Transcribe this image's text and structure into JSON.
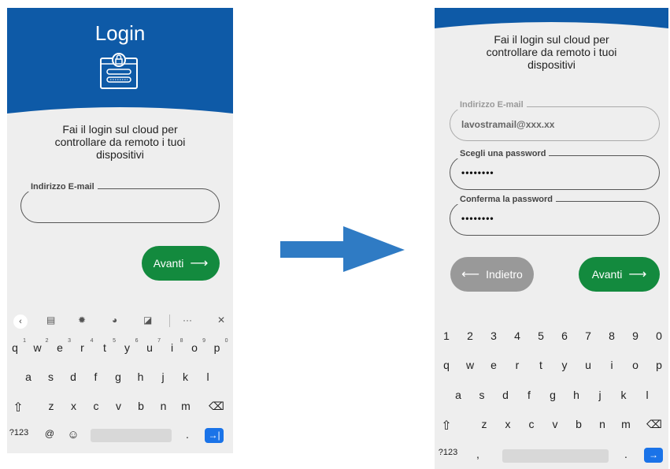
{
  "left_screen": {
    "title": "Login",
    "message_lines": [
      "Fai il login sul cloud per",
      "controllare da remoto i tuoi",
      "dispositivi"
    ],
    "email_label": "Indirizzo E-mail",
    "email_value": "",
    "next_button": "Avanti",
    "header_color": "#0e5aa7",
    "icon": "login-form-lock-icon"
  },
  "right_screen": {
    "message_lines": [
      "Fai il login sul cloud per",
      "controllare da remoto i tuoi",
      "dispositivi"
    ],
    "email_label": "Indirizzo E-mail",
    "email_value": "lavostramail@xxx.xx",
    "password_label": "Scegli una password",
    "password_value": "••••••••",
    "confirm_label": "Conferma la password",
    "confirm_value": "••••••••",
    "back_button": "Indietro",
    "next_button": "Avanti"
  },
  "keyboard_left": {
    "toolbar_icons": [
      "chevron-left-icon",
      "clipboard-icon",
      "gear-icon",
      "palette-icon",
      "sticker-icon",
      "more-icon",
      "mic-off-icon"
    ],
    "row1": [
      "q",
      "w",
      "e",
      "r",
      "t",
      "y",
      "u",
      "i",
      "o",
      "p"
    ],
    "row1_hints": [
      "1",
      "2",
      "3",
      "4",
      "5",
      "6",
      "7",
      "8",
      "9",
      "0"
    ],
    "row2": [
      "a",
      "s",
      "d",
      "f",
      "g",
      "h",
      "j",
      "k",
      "l"
    ],
    "row3": [
      "z",
      "x",
      "c",
      "v",
      "b",
      "n",
      "m"
    ],
    "symbols_key": "?123",
    "at_key": "@",
    "period_key": "."
  },
  "keyboard_right": {
    "numbers": [
      "1",
      "2",
      "3",
      "4",
      "5",
      "6",
      "7",
      "8",
      "9",
      "0"
    ],
    "row1": [
      "q",
      "w",
      "e",
      "r",
      "t",
      "y",
      "u",
      "i",
      "o",
      "p"
    ],
    "row2": [
      "a",
      "s",
      "d",
      "f",
      "g",
      "h",
      "j",
      "k",
      "l"
    ],
    "row3": [
      "z",
      "x",
      "c",
      "v",
      "b",
      "n",
      "m"
    ],
    "symbols_key": "?123",
    "comma_key": ",",
    "period_key": "."
  },
  "colors": {
    "header_blue": "#0e5aa7",
    "green": "#138a3e",
    "gray_button": "#999999",
    "arrow_blue": "#2f7bc4",
    "enter_blue": "#1a73e8"
  }
}
